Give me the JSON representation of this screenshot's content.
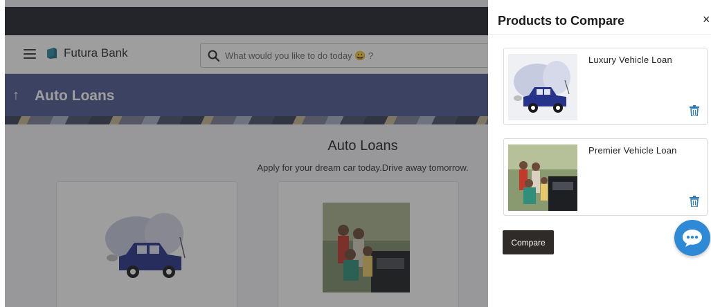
{
  "brand": {
    "name": "Futura Bank"
  },
  "search": {
    "placeholder": "What would you like to do today 😀 ?"
  },
  "banner": {
    "back_arrow": "↑",
    "title": "Auto Loans"
  },
  "content": {
    "title": "Auto Loans",
    "subtitle": "Apply for your dream car today.Drive away tomorrow."
  },
  "panel": {
    "title": "Products to Compare",
    "close": "×",
    "products": [
      {
        "name": "Luxury Vehicle Loan",
        "image": "car-illustration"
      },
      {
        "name": "Premier Vehicle Loan",
        "image": "family-with-car-photo"
      }
    ],
    "compare_label": "Compare"
  },
  "colors": {
    "topbar": "#21232d",
    "banner": "#4e5890",
    "compare_button": "#2e2b29",
    "chat_button": "#2e8ad6",
    "trash_icon": "#2e7bb8"
  },
  "icons": [
    "hamburger-menu-icon",
    "bank-logo-icon",
    "search-icon",
    "back-arrow-icon",
    "close-icon",
    "trash-icon",
    "chat-icon"
  ]
}
